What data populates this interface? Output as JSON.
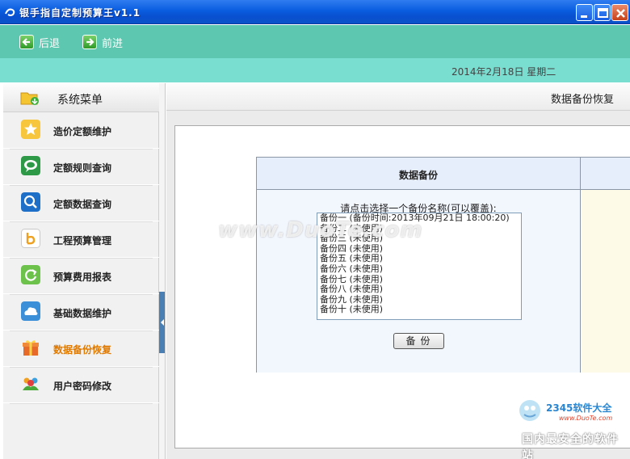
{
  "window": {
    "title": "银手指自定制预算王v1.1",
    "icons": [
      "app-icon",
      "minimize-icon",
      "maximize-icon",
      "close-icon"
    ]
  },
  "nav": {
    "back_label": "后退",
    "forward_label": "前进"
  },
  "datebar": {
    "date": "2014年2月18日  星期二"
  },
  "sidebar": {
    "title": "系统菜单",
    "items": [
      {
        "label": "造价定额维护",
        "icon": "star-icon"
      },
      {
        "label": "定额规则查询",
        "icon": "chat-bubble-icon"
      },
      {
        "label": "定额数据查询",
        "icon": "magnifier-icon"
      },
      {
        "label": "工程预算管理",
        "icon": "letter-b-icon"
      },
      {
        "label": "预算费用报表",
        "icon": "refresh-icon"
      },
      {
        "label": "基础数据维护",
        "icon": "cloud-icon"
      },
      {
        "label": "数据备份恢复",
        "icon": "gift-icon",
        "active": true
      },
      {
        "label": "用户密码修改",
        "icon": "users-icon"
      }
    ]
  },
  "main": {
    "page_title": "数据备份恢复",
    "backup": {
      "header": "数据备份",
      "prompt": "请点击选择一个备份名称(可以覆盖):",
      "options": [
        "备份一 (备份时间:2013年09月21日 18:00:20)",
        "备份二 (未使用)",
        "备份三 (未使用)",
        "备份四 (未使用)",
        "备份五 (未使用)",
        "备份六 (未使用)",
        "备份七 (未使用)",
        "备份八 (未使用)",
        "备份九 (未使用)",
        "备份十 (未使用)"
      ],
      "button_label": "备份"
    }
  },
  "overlay": {
    "watermark": "www.DuoTe.com",
    "corner_brand": "2345软件大全",
    "corner_site": "www.DuoTe.com",
    "corner_caption": "国内最安全的软件站"
  },
  "colors": {
    "titlebar": "#0a5de0",
    "navbar": "#5ec7b0",
    "datebar": "#79ddd0",
    "active_menu": "#e07a00"
  }
}
